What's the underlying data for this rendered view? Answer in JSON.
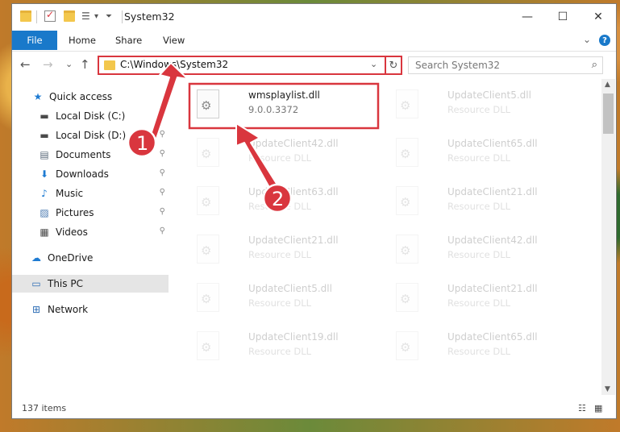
{
  "window": {
    "title": "System32",
    "minimize": "—",
    "maximize": "☐",
    "close": "✕"
  },
  "ribbon": {
    "tabs": [
      "File",
      "Home",
      "Share",
      "View"
    ],
    "expand": "⌄",
    "help": "?"
  },
  "nav": {
    "back": "←",
    "forward": "→",
    "recent": "⌄",
    "up": "↑",
    "address": "C:\\Windows\\System32",
    "address_dropdown": "⌄",
    "refresh": "↻",
    "search_placeholder": "Search System32",
    "search_icon": "⌕"
  },
  "sidebar": {
    "items": [
      {
        "label": "Quick access",
        "icon": "star-icon",
        "glyph": "★",
        "color": "#1e7bd2",
        "pinned": false
      },
      {
        "label": "Local Disk (C:)",
        "icon": "drive-icon",
        "glyph": "▬",
        "color": "#4a4a4a",
        "pinned": true
      },
      {
        "label": "Local Disk (D:)",
        "icon": "drive-icon",
        "glyph": "▬",
        "color": "#4a4a4a",
        "pinned": true
      },
      {
        "label": "Documents",
        "icon": "document-icon",
        "glyph": "▤",
        "color": "#5a6a7a",
        "pinned": true
      },
      {
        "label": "Downloads",
        "icon": "download-icon",
        "glyph": "⬇",
        "color": "#1e7bd2",
        "pinned": true
      },
      {
        "label": "Music",
        "icon": "music-icon",
        "glyph": "♪",
        "color": "#1e7bd2",
        "pinned": true
      },
      {
        "label": "Pictures",
        "icon": "pictures-icon",
        "glyph": "▨",
        "color": "#4a7ab0",
        "pinned": true
      },
      {
        "label": "Videos",
        "icon": "video-icon",
        "glyph": "▦",
        "color": "#4a4a4a",
        "pinned": true
      },
      {
        "label": "OneDrive",
        "icon": "cloud-icon",
        "glyph": "☁",
        "color": "#1e7bd2",
        "pinned": false
      },
      {
        "label": "This PC",
        "icon": "computer-icon",
        "glyph": "▭",
        "color": "#2d6db5",
        "pinned": false
      },
      {
        "label": "Network",
        "icon": "network-icon",
        "glyph": "⊞",
        "color": "#2d6db5",
        "pinned": false
      }
    ],
    "pin_glyph": "📌"
  },
  "files": [
    {
      "name": "wmsplaylist.dll",
      "sub": "9.0.0.3372"
    },
    {
      "name": "UpdateClient5.dll",
      "sub": "Resource DLL"
    },
    {
      "name": "UpdateClient42.dll",
      "sub": "Resource DLL"
    },
    {
      "name": "UpdateClient65.dll",
      "sub": "Resource DLL"
    },
    {
      "name": "UpdateClient63.dll",
      "sub": "Resource DLL"
    },
    {
      "name": "UpdateClient21.dll",
      "sub": "Resource DLL"
    },
    {
      "name": "UpdateClient21.dll",
      "sub": "Resource DLL"
    },
    {
      "name": "UpdateClient42.dll",
      "sub": "Resource DLL"
    },
    {
      "name": "UpdateClient5.dll",
      "sub": "Resource DLL"
    },
    {
      "name": "UpdateClient21.dll",
      "sub": "Resource DLL"
    },
    {
      "name": "UpdateClient19.dll",
      "sub": "Resource DLL"
    },
    {
      "name": "UpdateClient65.dll",
      "sub": "Resource DLL"
    }
  ],
  "status": {
    "count": "137 items"
  },
  "annotations": {
    "step1": "1",
    "step2": "2",
    "color": "#d9363e"
  }
}
